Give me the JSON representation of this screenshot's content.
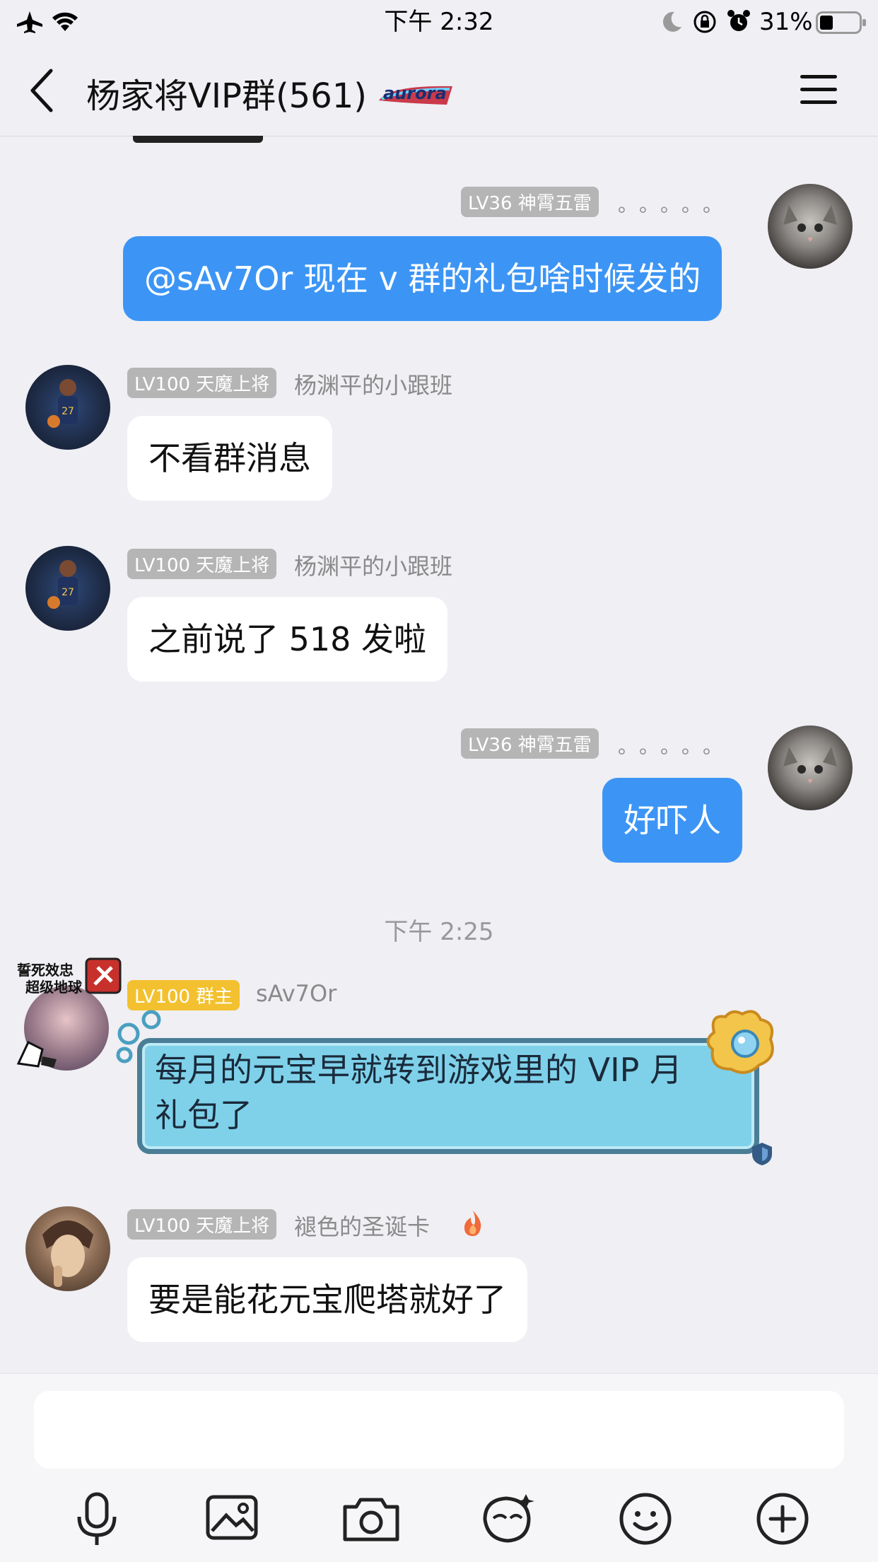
{
  "status": {
    "time": "下午 2:32",
    "battery": "31%"
  },
  "nav": {
    "title": "杨家将VIP群(561)",
    "title_badge": "aurora"
  },
  "messages": [
    {
      "side": "right",
      "level": "LV36 神霄五雷",
      "name": "。。。。。",
      "text": "@sAv7Or 现在 v 群的礼包啥时候发的"
    },
    {
      "side": "left",
      "level": "LV100 天魔上将",
      "name": "杨渊平的小跟班",
      "text": "不看群消息"
    },
    {
      "side": "left",
      "level": "LV100 天魔上将",
      "name": "杨渊平的小跟班",
      "text": "之前说了 518 发啦"
    },
    {
      "side": "right",
      "level": "LV36 神霄五雷",
      "name": "。。。。。",
      "text": "好吓人"
    },
    {
      "side": "left",
      "level": "LV100 群主",
      "name": "sAv7Or",
      "text_line1": "每月的元宝早就转到游戏里的 VIP 月",
      "text_line2": "礼包了",
      "frame_badge_line1": "誓死效忠",
      "frame_badge_line2": "超级地球"
    },
    {
      "side": "left",
      "level": "LV100 天魔上将",
      "name": "褪色的圣诞卡",
      "text": "要是能花元宝爬塔就好了"
    }
  ],
  "timestamp": "下午 2:25",
  "input": {
    "placeholder": ""
  },
  "colors": {
    "me_bubble": "#3c95f5",
    "owner_badge": "#f3c12f",
    "special_bubble": "#7fd1ea"
  }
}
